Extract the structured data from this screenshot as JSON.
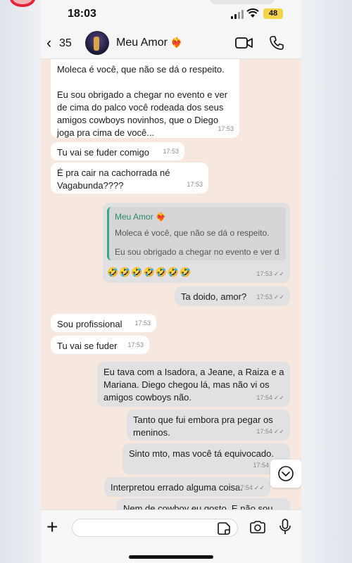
{
  "status": {
    "time": "18:03",
    "battery": "48"
  },
  "header": {
    "back_count": "35",
    "contact_name": "Meu Amor",
    "contact_emoji": "❤️‍🔥"
  },
  "messages": [
    {
      "dir": "in",
      "text": "Moleca é você, que não se dá o respeito.\n\nEu sou obrigado a chegar no evento e ver de cima do palco você rodeada dos seus amigos cowboys novinhos, que o Diego joga pra cima de você...",
      "time": "17:53"
    },
    {
      "dir": "in",
      "text": "Tu vai se fuder comigo",
      "time": "17:53"
    },
    {
      "dir": "in",
      "text": "É pra cair na cachorrada né Vagabunda????",
      "time": "17:53"
    },
    {
      "dir": "out",
      "quote_author": "Meu Amor",
      "quote_text_1": "Moleca é você, que não se dá o respeito.",
      "quote_text_2": "Eu sou obrigado a chegar no evento e ver d...",
      "text": "🤣🤣🤣🤣🤣🤣🤣",
      "time": "17:53"
    },
    {
      "dir": "out",
      "text": "Ta doido, amor?",
      "time": "17:53"
    },
    {
      "dir": "in",
      "text": "Sou profissional",
      "time": "17:53"
    },
    {
      "dir": "in",
      "text": "Tu vai se fuder",
      "time": "17:53"
    },
    {
      "dir": "out",
      "text": "Eu tava com a Isadora, a Jeane, a Raiza e a Mariana. Diego chegou lá, mas não vi os amigos cowboys não.",
      "time": "17:54"
    },
    {
      "dir": "out",
      "text": "Tanto que fui embora pra pegar os meninos.",
      "time": "17:54"
    },
    {
      "dir": "out",
      "text": "Sinto mto, mas você tá equivocado.",
      "time": "17:54"
    },
    {
      "dir": "out",
      "text": "Interpretou errado alguma coisa.",
      "time": "17:54"
    },
    {
      "dir": "out",
      "text": "Nem de cowboy eu gosto. E não sou",
      "time": ""
    }
  ],
  "icons": {
    "back": "chevron-left-icon",
    "video": "video-camera-icon",
    "call": "phone-icon",
    "add": "plus-icon",
    "sticker": "sticker-icon",
    "camera": "camera-icon",
    "mic": "microphone-icon",
    "scroll": "chevron-down-icon"
  },
  "colors": {
    "incoming_bubble": "#ffffff",
    "outgoing_bubble": "#e1e1e3",
    "chat_background": "#f6e7df",
    "quote_accent": "#3aa981"
  }
}
